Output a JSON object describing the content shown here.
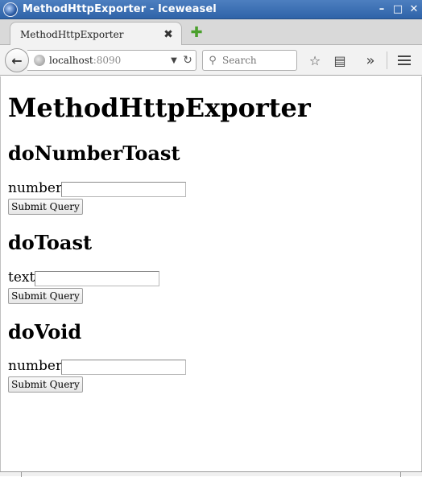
{
  "window": {
    "title": "MethodHttpExporter - Iceweasel",
    "minimize_icon": "minimize-icon",
    "maximize_icon": "maximize-icon",
    "close_icon": "close-icon"
  },
  "tabs": [
    {
      "label": "MethodHttpExporter",
      "active": true
    }
  ],
  "navbar": {
    "url_host": "localhost",
    "url_port": ":8090",
    "search_placeholder": "Search"
  },
  "page": {
    "title": "MethodHttpExporter",
    "sections": [
      {
        "heading": "doNumberToast",
        "field_label": "number",
        "field_value": "",
        "submit_label": "Submit Query"
      },
      {
        "heading": "doToast",
        "field_label": "text",
        "field_value": "",
        "submit_label": "Submit Query"
      },
      {
        "heading": "doVoid",
        "field_label": "number",
        "field_value": "",
        "submit_label": "Submit Query"
      }
    ]
  },
  "colors": {
    "titlebar": "#2f63a8",
    "newtab_plus": "#4aa02c"
  }
}
